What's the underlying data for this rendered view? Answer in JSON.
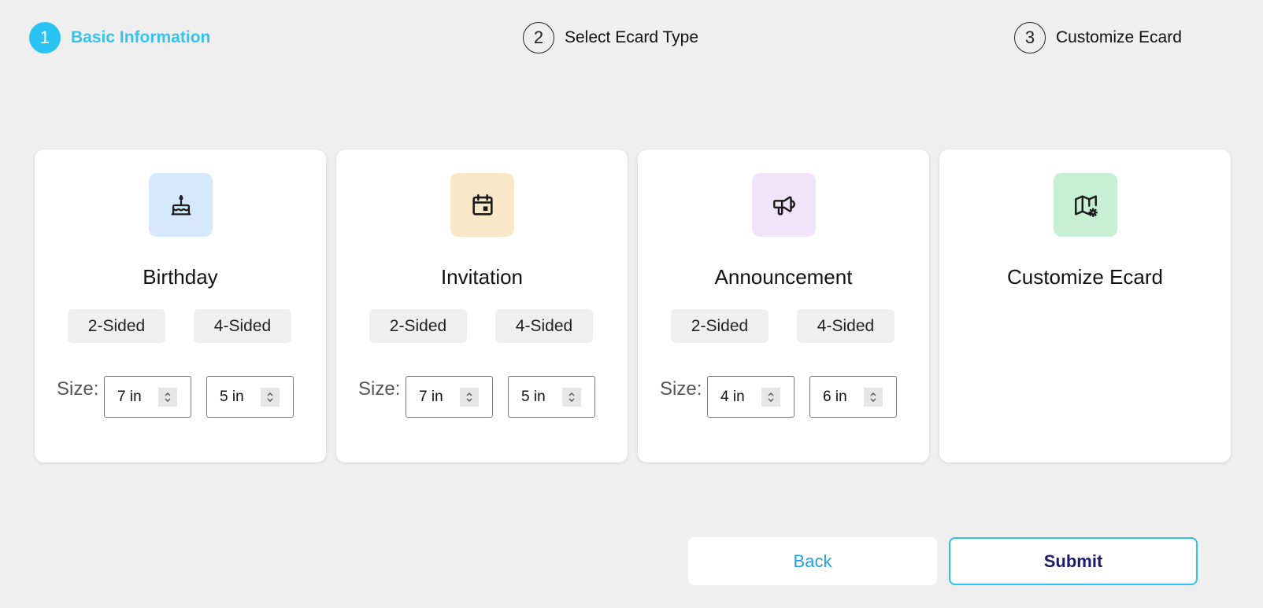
{
  "stepper": {
    "steps": [
      {
        "number": "1",
        "label": "Basic Information"
      },
      {
        "number": "2",
        "label": "Select Ecard Type"
      },
      {
        "number": "3",
        "label": "Customize Ecard"
      }
    ],
    "active_step": 1
  },
  "cards": [
    {
      "title": "Birthday",
      "icon": "birthday-cake-icon",
      "icon_bg": "#d6e9fc",
      "options": [
        "2-Sided",
        "4-Sided"
      ],
      "size_label": "Size:",
      "width": "7 in",
      "height": "5 in"
    },
    {
      "title": "Invitation",
      "icon": "calendar-icon",
      "icon_bg": "#f8e8c8",
      "options": [
        "2-Sided",
        "4-Sided"
      ],
      "size_label": "Size:",
      "width": "7 in",
      "height": "5 in"
    },
    {
      "title": "Announcement",
      "icon": "megaphone-icon",
      "icon_bg": "#f1e3fa",
      "options": [
        "2-Sided",
        "4-Sided"
      ],
      "size_label": "Size:",
      "width": "4 in",
      "height": "6 in"
    },
    {
      "title": "Customize Ecard",
      "icon": "map-settings-icon",
      "icon_bg": "#c6efd4"
    }
  ],
  "actions": {
    "back_label": "Back",
    "submit_label": "Submit"
  }
}
